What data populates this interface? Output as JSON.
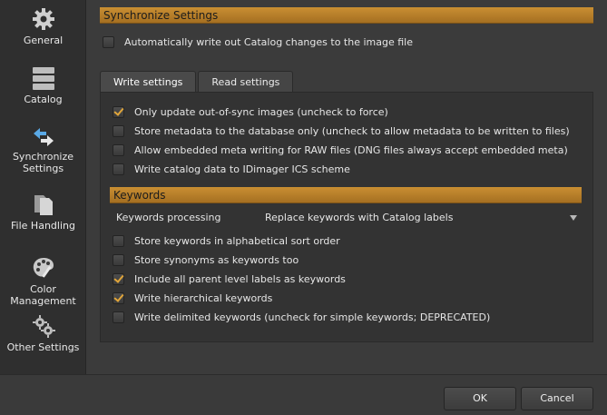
{
  "sidebar": {
    "items": [
      {
        "label": "General",
        "icon": "gear-icon"
      },
      {
        "label": "Catalog",
        "icon": "database-icon"
      },
      {
        "label": "Synchronize Settings",
        "icon": "sync-arrows-icon"
      },
      {
        "label": "File Handling",
        "icon": "files-icon"
      },
      {
        "label": "Color Management",
        "icon": "palette-icon"
      },
      {
        "label": "Other Settings",
        "icon": "gears-icon"
      }
    ]
  },
  "sync": {
    "header": "Synchronize Settings",
    "auto_write": {
      "label": "Automatically write out Catalog changes to the image file",
      "checked": false
    }
  },
  "tabs": [
    {
      "label": "Write settings",
      "active": true
    },
    {
      "label": "Read settings",
      "active": false
    }
  ],
  "write": {
    "options": [
      {
        "label": "Only update out-of-sync images (uncheck to force)",
        "checked": true
      },
      {
        "label": "Store metadata to the database only (uncheck to allow metadata to be written to files)",
        "checked": false
      },
      {
        "label": "Allow embedded meta writing for RAW files (DNG files always accept embedded meta)",
        "checked": false
      },
      {
        "label": "Write catalog data to IDimager ICS scheme",
        "checked": false
      }
    ]
  },
  "keywords": {
    "header": "Keywords",
    "processing_label": "Keywords processing",
    "processing_value": "Replace keywords with Catalog labels",
    "options": [
      {
        "label": "Store keywords in alphabetical sort order",
        "checked": false
      },
      {
        "label": "Store synonyms as keywords too",
        "checked": false
      },
      {
        "label": "Include all parent level labels as keywords",
        "checked": true
      },
      {
        "label": "Write hierarchical keywords",
        "checked": true
      },
      {
        "label": "Write delimited keywords (uncheck for simple keywords; DEPRECATED)",
        "checked": false
      }
    ]
  },
  "footer": {
    "ok_label": "OK",
    "cancel_label": "Cancel"
  },
  "colors": {
    "accent": "#b77f2a",
    "check": "#e0a53a",
    "background": "#3b3b3b"
  }
}
